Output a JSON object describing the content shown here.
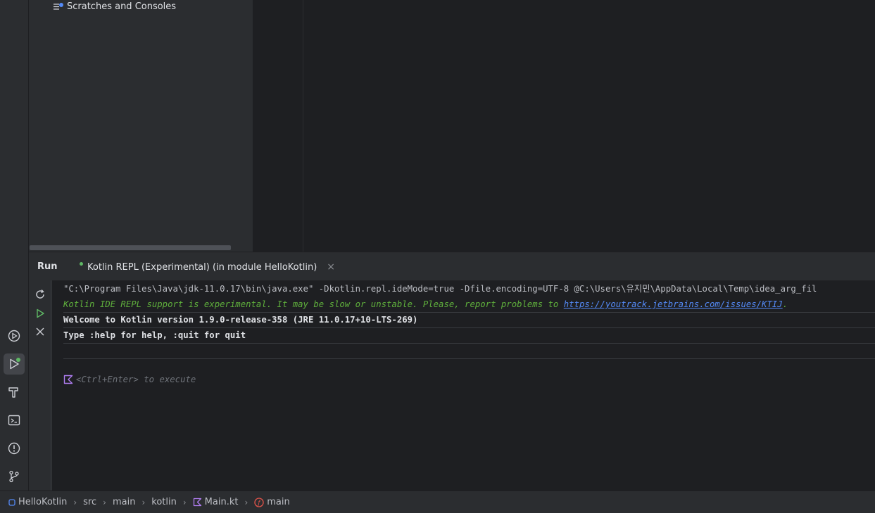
{
  "project_panel": {
    "scratches_label": "Scratches and Consoles"
  },
  "run_window": {
    "title": "Run",
    "tab_label": "Kotlin REPL (Experimental) (in module HelloKotlin)",
    "tab_close": "×"
  },
  "console": {
    "command_line": "\"C:\\Program Files\\Java\\jdk-11.0.17\\bin\\java.exe\" -Dkotlin.repl.ideMode=true -Dfile.encoding=UTF-8 @C:\\Users\\유지민\\AppData\\Local\\Temp\\idea_arg_fil",
    "warning_text": "Kotlin IDE REPL support is experimental. It may be slow or unstable. Please, report problems to ",
    "warning_link": "https://youtrack.jetbrains.com/issues/KTIJ",
    "warning_suffix": ".",
    "welcome": "Welcome to Kotlin version 1.9.0-release-358 (JRE 11.0.17+10-LTS-269)",
    "help": "Type :help for help, :quit for quit",
    "input_placeholder": "<Ctrl+Enter> to execute"
  },
  "breadcrumbs": {
    "project": "HelloKotlin",
    "src": "src",
    "main_dir": "main",
    "kotlin_dir": "kotlin",
    "file": "Main.kt",
    "function": "main"
  },
  "icons": {
    "activity": [
      "services-icon",
      "run-icon",
      "build-icon",
      "terminal-icon",
      "problems-icon",
      "git-icon"
    ],
    "run_tools": [
      "rerun-icon",
      "execute-icon",
      "close-icon"
    ]
  },
  "colors": {
    "accent": "#3574f0",
    "success_green": "#5fb865",
    "kotlin_purple": "#b07ef2",
    "error_red": "#e5544b"
  }
}
